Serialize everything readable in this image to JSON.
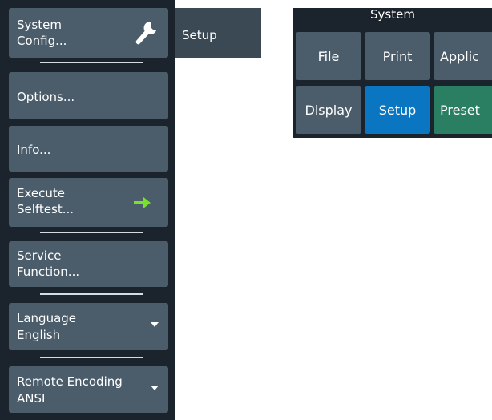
{
  "left_panel": {
    "items": [
      {
        "label_line1": "System",
        "label_line2": "Config...",
        "icon": "wrench-icon"
      },
      {
        "label_line1": "Options...",
        "label_line2": ""
      },
      {
        "label_line1": "Info...",
        "label_line2": ""
      },
      {
        "label_line1": "Execute",
        "label_line2": "Selftest...",
        "icon": "arrow-right-icon"
      },
      {
        "label_line1": "Service",
        "label_line2": "Function..."
      },
      {
        "label_line1": "Language",
        "label_line2": "English",
        "icon": "chevron-down-icon"
      },
      {
        "label_line1": "Remote Encoding",
        "label_line2": "ANSI",
        "icon": "chevron-down-icon"
      }
    ]
  },
  "setup_tab": {
    "label": "Setup"
  },
  "system_panel": {
    "title": "System",
    "buttons": [
      {
        "label": "File",
        "color": "#4b5c6a"
      },
      {
        "label": "Print",
        "color": "#4b5c6a"
      },
      {
        "label": "Applic",
        "color": "#4b5c6a"
      },
      {
        "label": "Display",
        "color": "#4b5c6a"
      },
      {
        "label": "Setup",
        "color": "#0a76c2"
      },
      {
        "label": "Preset",
        "color": "#2a7f62"
      }
    ]
  },
  "colors": {
    "panel_bg": "#1b242c",
    "button_bg": "#4b5c6a",
    "accent_blue": "#0a76c2",
    "accent_green": "#2a7f62",
    "arrow_green": "#7be02d"
  }
}
